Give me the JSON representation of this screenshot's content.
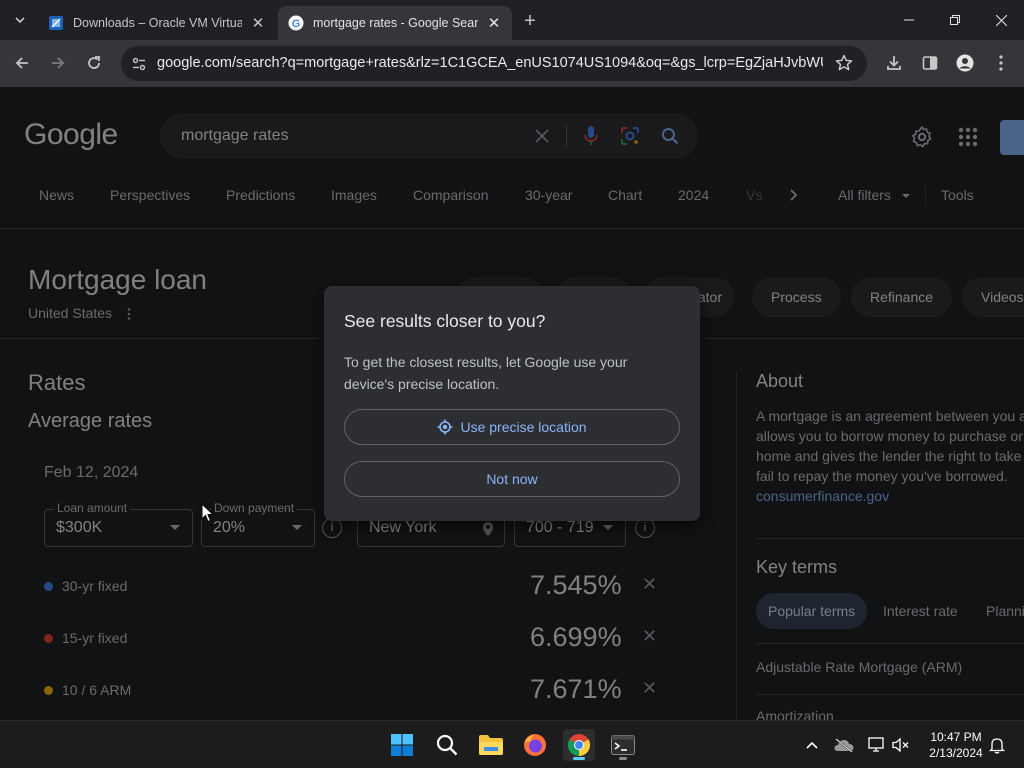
{
  "browser": {
    "tabs": [
      {
        "title": "Downloads – Oracle VM Virtual",
        "active": false,
        "favicon": "virtualbox-icon"
      },
      {
        "title": "mortgage rates - Google Search",
        "active": true,
        "favicon": "google-icon"
      }
    ],
    "url": "google.com/search?q=mortgage+rates&rlz=1C1GCEA_enUS1074US1094&oq=&gs_lcrp=EgZjaHJvbWUqE..."
  },
  "google": {
    "logo": "Google",
    "query": "mortgage rates",
    "chips": [
      "News",
      "Perspectives",
      "Predictions",
      "Images",
      "Comparison",
      "30-year",
      "Chart",
      "2024",
      "Vs",
      "All filters",
      "Tools"
    ],
    "more_chips_icon": "chevron-right-icon"
  },
  "knowledge_panel": {
    "title": "Mortgage loan",
    "subtitle": "United States",
    "pills": [
      "Process",
      "Refinance",
      "Videos"
    ],
    "partial_pill": "ator"
  },
  "rates": {
    "heading": "Rates",
    "subheading": "Average rates",
    "date": "Feb 12, 2024",
    "loan_amount_label": "Loan amount",
    "loan_amount_value": "$300K",
    "down_payment_label": "Down payment",
    "down_payment_value": "20%",
    "location_value": "New York",
    "credit_value": "700 - 719",
    "rows": [
      {
        "name": "30-yr fixed",
        "value": "7.545%",
        "color": "#4285f4"
      },
      {
        "name": "15-yr fixed",
        "value": "6.699%",
        "color": "#ea4335"
      },
      {
        "name": "10 / 6 ARM",
        "value": "7.671%",
        "color": "#fbbc04"
      }
    ]
  },
  "about": {
    "heading": "About",
    "text": "A mortgage is an agreement between you a allows you to borrow money to purchase or home and gives the lender the right to take you fail to repay the money you've borrowed.",
    "source": "consumerfinance.gov",
    "key_terms_heading": "Key terms",
    "key_terms": [
      "Popular terms",
      "Interest rate",
      "Planni"
    ],
    "terms": [
      "Adjustable Rate Mortgage (ARM)",
      "Amortization"
    ]
  },
  "dialog": {
    "title": "See results closer to you?",
    "body": "To get the closest results, let Google use your device's precise location.",
    "primary": "Use precise location",
    "secondary": "Not now"
  },
  "taskbar": {
    "time": "10:47 PM",
    "date": "2/13/2024"
  },
  "colors": {
    "accent": "#8ab4f8",
    "background": "#202124"
  }
}
